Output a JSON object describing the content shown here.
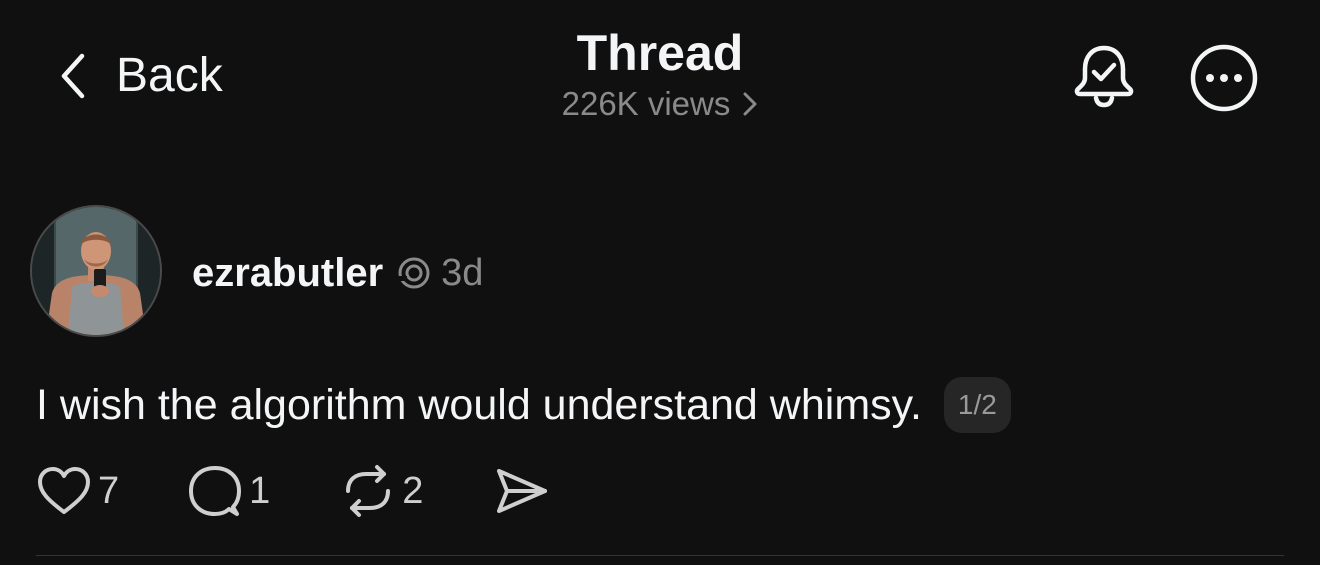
{
  "header": {
    "back_label": "Back",
    "title": "Thread",
    "views": "226K views"
  },
  "post": {
    "username": "ezrabutler",
    "time": "3d",
    "text": "I wish the algorithm would understand whimsy.",
    "page_indicator": "1/2",
    "likes": "7",
    "replies": "1",
    "reposts": "2"
  },
  "icons": {
    "back": "chevron-left-icon",
    "views": "chevron-right-icon",
    "notify": "bell-check-icon",
    "more": "more-horizontal-circle-icon",
    "threads": "threads-logo-icon",
    "like": "heart-icon",
    "reply": "comment-icon",
    "repost": "repost-icon",
    "share": "send-icon"
  },
  "colors": {
    "background": "#101010",
    "text": "#f3f5f7",
    "muted": "#8a8a8a",
    "badge": "#262626"
  }
}
